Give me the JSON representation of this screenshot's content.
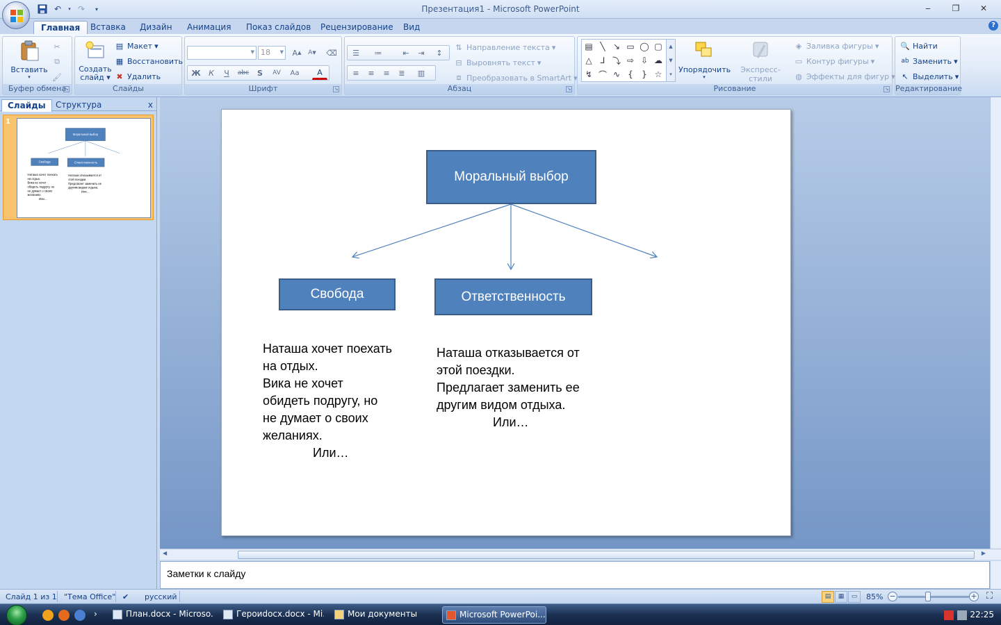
{
  "window": {
    "title": "Презентация1 - Microsoft PowerPoint",
    "min": "‒",
    "max": "❐",
    "close": "✕"
  },
  "tabs": [
    "Главная",
    "Вставка",
    "Дизайн",
    "Анимация",
    "Показ слайдов",
    "Рецензирование",
    "Вид"
  ],
  "ribbon": {
    "clipboard": {
      "label": "Буфер обмена",
      "paste": "Вставить"
    },
    "slides": {
      "label": "Слайды",
      "create_line1": "Создать",
      "create_line2": "слайд",
      "layout": "Макет",
      "reset": "Восстановить",
      "delete": "Удалить"
    },
    "font": {
      "label": "Шрифт",
      "font_name": "",
      "font_size": "18"
    },
    "paragraph": {
      "label": "Абзац",
      "text_direction": "Направление текста",
      "align_text": "Выровнять текст",
      "smartart": "Преобразовать в SmartArt"
    },
    "drawing": {
      "label": "Рисование",
      "arrange": "Упорядочить",
      "quick_styles": "Экспресс-стили",
      "fill": "Заливка фигуры",
      "outline": "Контур фигуры",
      "effects": "Эффекты для фигур"
    },
    "editing": {
      "label": "Редактирование",
      "find": "Найти",
      "replace": "Заменить",
      "select": "Выделить"
    }
  },
  "left_pane": {
    "tab_slides": "Слайды",
    "tab_outline": "Структура",
    "close": "x",
    "slide_number": "1"
  },
  "slide": {
    "top_box": "Моральный выбор",
    "left_box": "Свобода",
    "mid_box": "Ответственность",
    "left_text": [
      "Наташа хочет поехать",
      "на отдых.",
      "Вика  не хочет",
      "обидеть подругу, но",
      "не думает о своих",
      "желаниях."
    ],
    "left_or": "Или…",
    "mid_text": [
      "Наташа отказывается от",
      "этой поездки.",
      "Предлагает заменить ее",
      "другим  видом отдыха."
    ],
    "mid_or": "Или…"
  },
  "notes": {
    "placeholder": "Заметки к слайду"
  },
  "status": {
    "slide_info": "Слайд 1 из 1",
    "theme": "\"Тема Office\"",
    "language": "русский",
    "zoom": "85%"
  },
  "taskbar": {
    "items": [
      "План.docx - Microso...",
      "Героиdocx.docx - Mi...",
      "Мои документы",
      "Microsoft PowerPoi..."
    ],
    "clock": "22:25"
  },
  "colors": {
    "shape_fill": "#4f81bd",
    "shape_border": "#385d8a",
    "ribbon_text": "#15428b",
    "selected_thumb": "#f9c36d"
  }
}
